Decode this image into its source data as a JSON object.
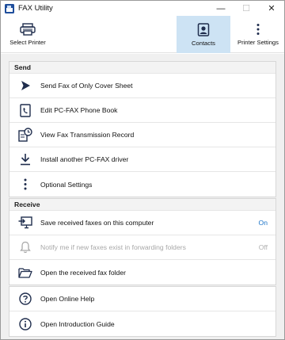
{
  "window": {
    "title": "FAX Utility"
  },
  "window_controls": {
    "minimize": "—",
    "maximize": "☐",
    "close": "✕"
  },
  "toolbar": {
    "select_printer": "Select Printer",
    "contacts": "Contacts",
    "printer_settings": "Printer Settings"
  },
  "send": {
    "header": "Send",
    "items": [
      {
        "label": "Send Fax of Only Cover Sheet",
        "icon": "send-arrow-icon"
      },
      {
        "label": "Edit PC-FAX Phone Book",
        "icon": "phone-book-icon"
      },
      {
        "label": "View Fax Transmission Record",
        "icon": "record-clock-icon"
      },
      {
        "label": "Install another PC-FAX driver",
        "icon": "download-icon"
      },
      {
        "label": "Optional Settings",
        "icon": "more-vertical-icon"
      }
    ]
  },
  "receive": {
    "header": "Receive",
    "items": [
      {
        "label": "Save received faxes on this computer",
        "value": "On",
        "icon": "save-to-pc-icon"
      },
      {
        "label": "Notify me if new faxes exist in forwarding folders",
        "value": "Off",
        "icon": "bell-icon",
        "disabled": true
      },
      {
        "label": "Open the received fax folder",
        "icon": "folder-open-icon"
      }
    ]
  },
  "help": {
    "items": [
      {
        "label": "Open Online Help",
        "icon": "question-icon"
      },
      {
        "label": "Open Introduction Guide",
        "icon": "info-icon"
      }
    ]
  },
  "colors": {
    "accent": "#1a73c8",
    "selected_tab": "#cde3f4",
    "icon": "#1f2d4d",
    "disabled": "#a8a8a8"
  }
}
